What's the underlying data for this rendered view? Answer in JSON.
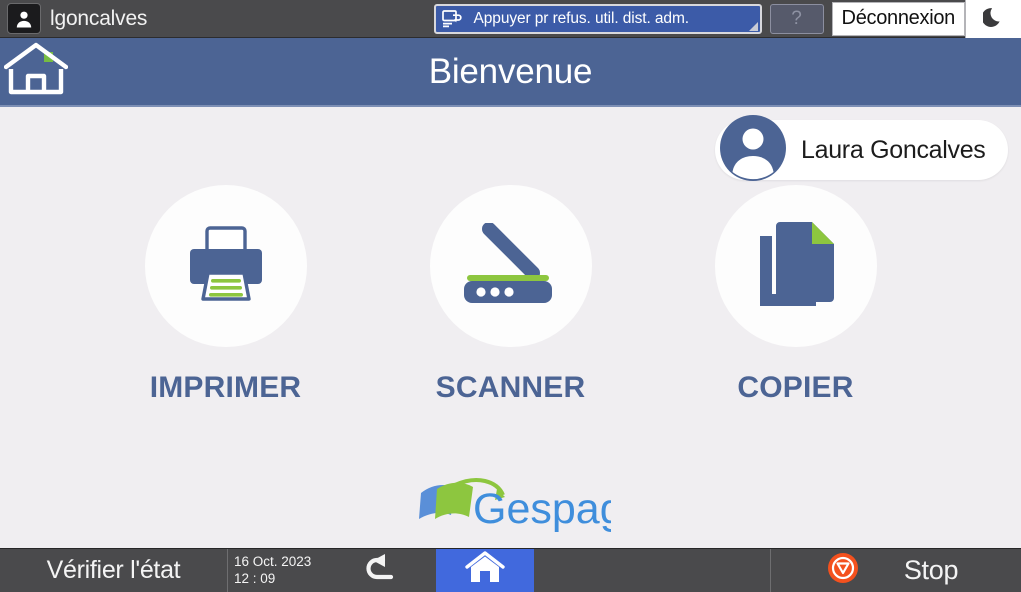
{
  "topbar": {
    "user_icon": "user-icon",
    "username": "lgoncalves",
    "status_button": {
      "icon": "remote-access-icon",
      "label": "Appuyer pr refus. util. dist. adm.",
      "background": "#3c5ba8"
    },
    "help_label": "?",
    "logout_label": "Déconnexion",
    "sleep_icon": "moon-icon"
  },
  "header": {
    "home_icon": "home-outline-icon",
    "title": "Bienvenue",
    "background": "#4c6494"
  },
  "user_card": {
    "avatar_icon": "avatar-icon",
    "name": "Laura Goncalves"
  },
  "tiles": [
    {
      "id": "imprimer",
      "icon": "printer-icon",
      "label": "IMPRIMER"
    },
    {
      "id": "scanner",
      "icon": "scanner-icon",
      "label": "SCANNER"
    },
    {
      "id": "copier",
      "icon": "copy-documents-icon",
      "label": "COPIER"
    }
  ],
  "brand": {
    "name": "Gespage",
    "logo_icon": "gespage-logo-icon",
    "blue": "#3f8edc",
    "green": "#8dc63f"
  },
  "bottombar": {
    "status_label": "Vérifier l'état",
    "date": "16 Oct. 2023",
    "time": "12 : 09",
    "back_icon": "back-arrow-icon",
    "home_icon": "home-filled-icon",
    "stop_icon": "stop-icon",
    "stop_label": "Stop",
    "stop_color": "#f4511e"
  },
  "colors": {
    "accent_blue": "#4c6494",
    "tile_label": "#4c6494",
    "green": "#8dc63f",
    "content_bg": "#f0eef1",
    "bar_bg": "#4a4a4c"
  }
}
